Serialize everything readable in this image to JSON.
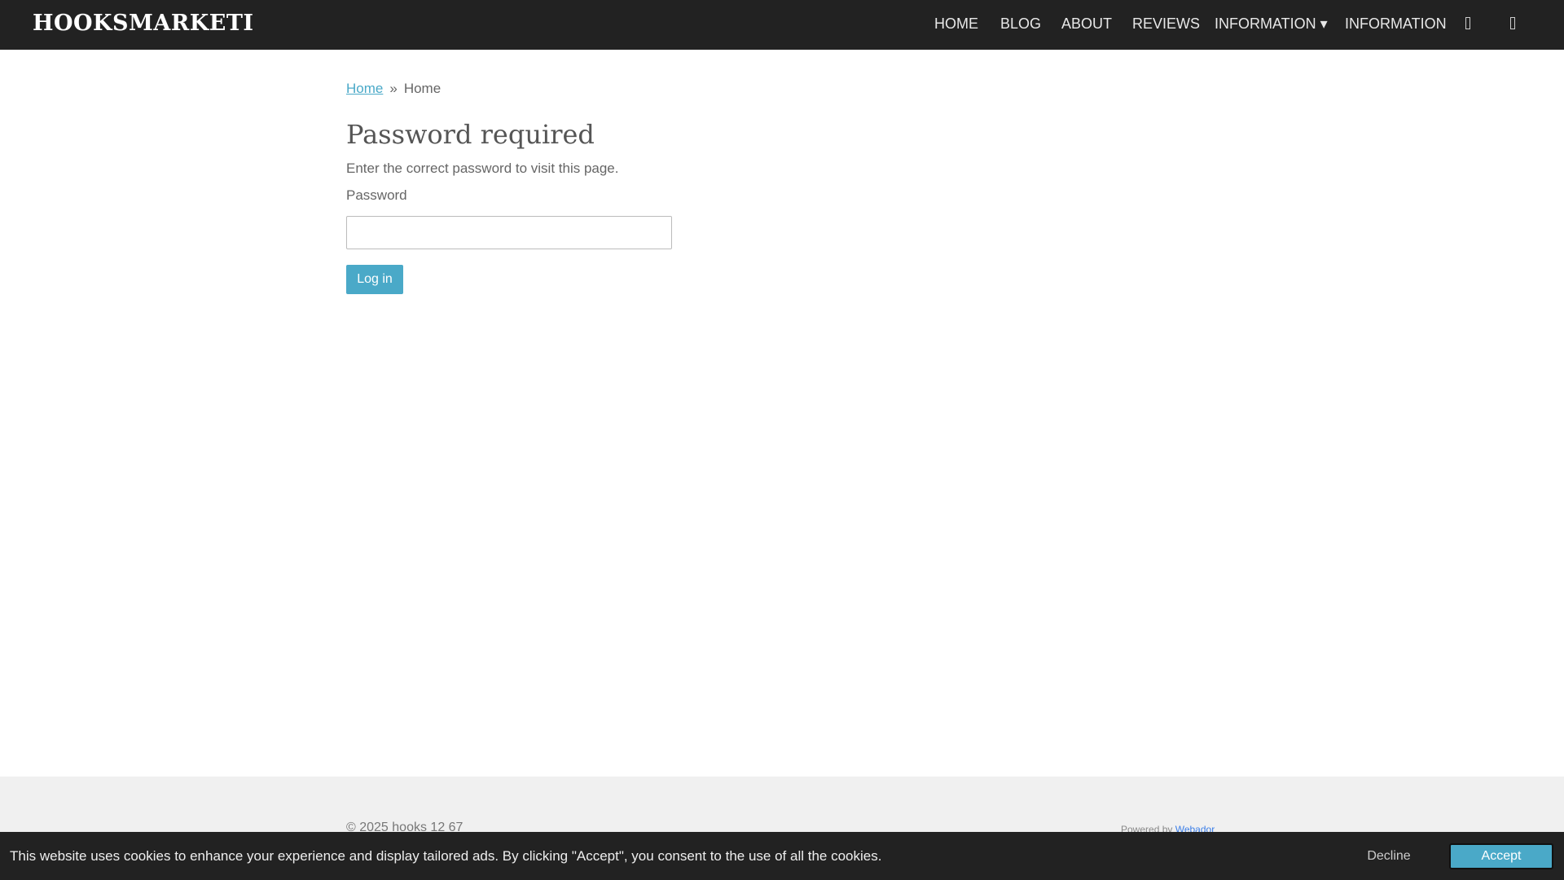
{
  "header": {
    "logo": "HOOKSMARKETI",
    "nav": [
      "HOME",
      "BLOG",
      "ABOUT",
      "REVIEWS",
      "INFORMATION ▾",
      "INFORMATION"
    ],
    "icons": [
      "account-icon",
      "cart-icon"
    ]
  },
  "breadcrumb": {
    "link": "Home",
    "separator": "»",
    "current": "Home"
  },
  "main": {
    "title": "Password required",
    "description": "Enter the correct password to visit this page.",
    "password_label": "Password",
    "password_value": "",
    "login_label": "Log in"
  },
  "footer": {
    "copyright": "© 2025 hooks 12 67",
    "powered_by": "Powered by",
    "powered_link": "Webador"
  },
  "cookie": {
    "text": "This website uses cookies to enhance your experience and display tailored ads. By clicking \"Accept\", you consent to the use of all the cookies.",
    "decline": "Decline",
    "accept": "Accept"
  },
  "colors": {
    "header_bg": "#222222",
    "accent": "#4aa9c8",
    "footer_bg": "#f0f0f0"
  }
}
